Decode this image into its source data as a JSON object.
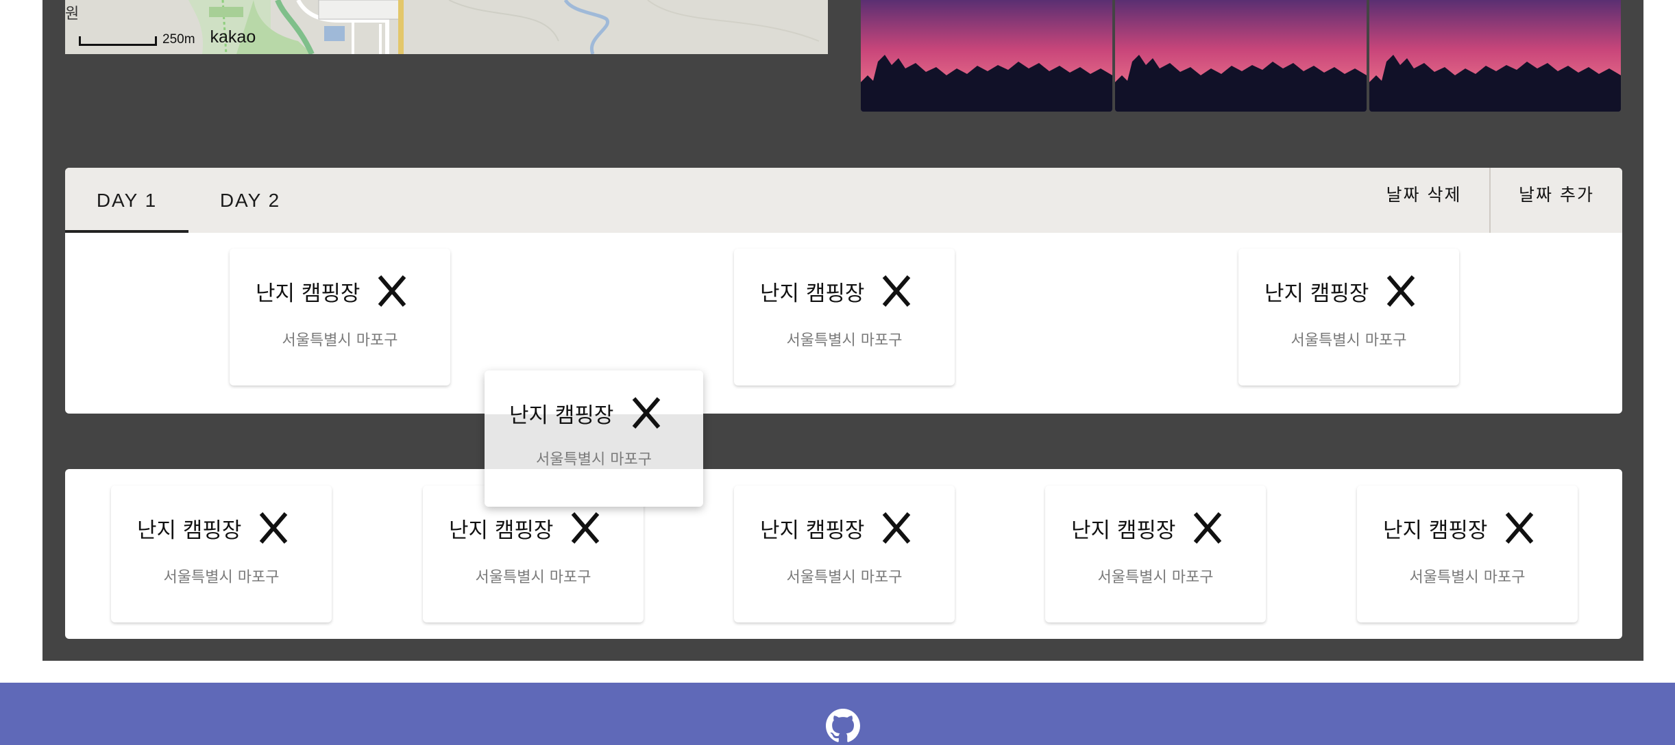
{
  "map": {
    "corner_text": "원",
    "scale_label": "250m",
    "brand": "kakao"
  },
  "tabs": [
    {
      "label": "DAY 1",
      "selected": true
    },
    {
      "label": "DAY 2",
      "selected": false
    }
  ],
  "day_actions": {
    "delete_label": "날짜 삭제",
    "add_label": "날짜 추가"
  },
  "day1_cards": [
    {
      "title": "난지 캠핑장",
      "address": "서울특별시 마포구"
    },
    {
      "title": "난지 캠핑장",
      "address": "서울특별시 마포구"
    },
    {
      "title": "난지 캠핑장",
      "address": "서울특별시 마포구"
    }
  ],
  "dragging_card": {
    "title": "난지 캠핑장",
    "address": "서울특별시 마포구"
  },
  "pool_cards": [
    {
      "title": "난지 캠핑장",
      "address": "서울특별시 마포구"
    },
    {
      "title": "난지 캠핑장",
      "address": "서울특별시 마포구"
    },
    {
      "title": "난지 캠핑장",
      "address": "서울특별시 마포구"
    },
    {
      "title": "난지 캠핑장",
      "address": "서울특별시 마포구"
    },
    {
      "title": "난지 캠핑장",
      "address": "서울특별시 마포구"
    }
  ],
  "icons": {
    "remove": "close-icon",
    "footer": "github-icon"
  },
  "colors": {
    "background_panel": "#444444",
    "tabbar": "#edebe8",
    "footer": "#5f69b8"
  }
}
